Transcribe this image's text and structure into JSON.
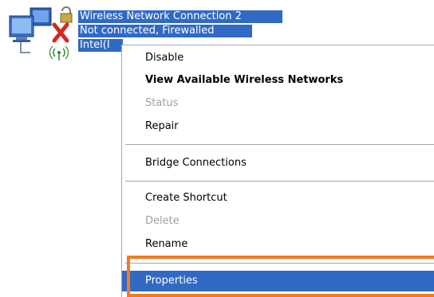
{
  "connection": {
    "name": "Wireless Network Connection 2",
    "status": "Not connected, Firewalled",
    "adapter": "Intel(I"
  },
  "menu": {
    "items": [
      {
        "label": "Disable",
        "state": "normal"
      },
      {
        "label": "View Available Wireless Networks",
        "state": "default"
      },
      {
        "label": "Status",
        "state": "disabled"
      },
      {
        "label": "Repair",
        "state": "normal"
      },
      {
        "label": "Bridge Connections",
        "state": "normal"
      },
      {
        "label": "Create Shortcut",
        "state": "normal"
      },
      {
        "label": "Delete",
        "state": "disabled"
      },
      {
        "label": "Rename",
        "state": "normal"
      },
      {
        "label": "Properties",
        "state": "selected"
      }
    ]
  },
  "colors": {
    "selection": "#316ac5",
    "highlight_border": "#f47a20",
    "disabled_text": "#a0a0a0"
  },
  "icons": [
    "network-connection-icon",
    "disconnected-x-icon",
    "firewall-lock-icon",
    "wireless-signal-icon"
  ]
}
